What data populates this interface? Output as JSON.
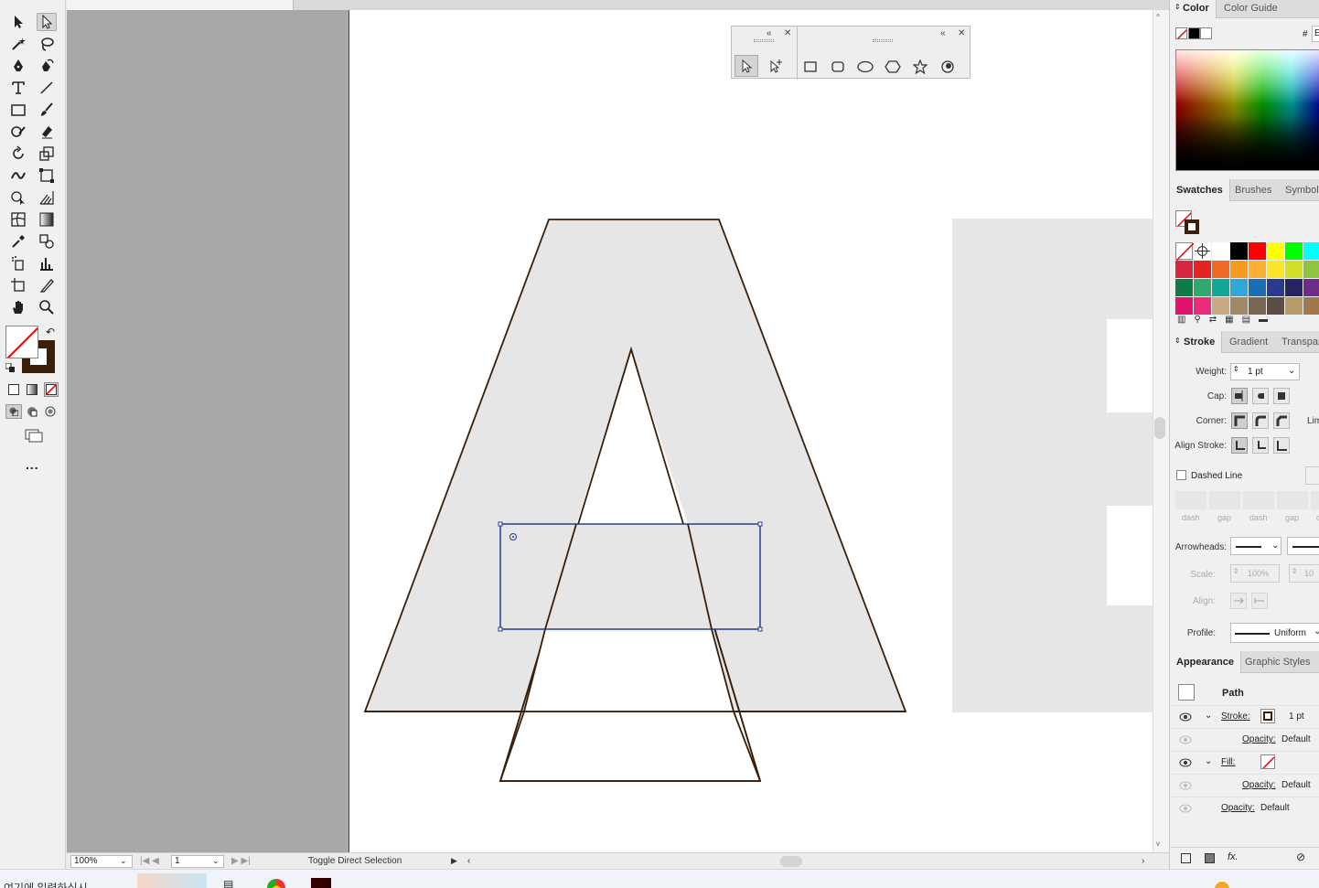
{
  "toolbar": {
    "tools": [
      "selection-tool",
      "direct-selection-tool",
      "magic-wand-tool",
      "lasso-tool",
      "pen-tool",
      "curvature-tool",
      "type-tool",
      "line-segment-tool",
      "rectangle-tool",
      "paintbrush-tool",
      "shaper-tool",
      "eraser-tool",
      "rotate-tool",
      "scale-tool",
      "width-tool",
      "free-transform-tool",
      "shape-builder-tool",
      "perspective-grid-tool",
      "mesh-tool",
      "gradient-tool",
      "eyedropper-tool",
      "blend-tool",
      "symbol-sprayer-tool",
      "column-graph-tool",
      "artboard-tool",
      "slice-tool",
      "hand-tool",
      "zoom-tool"
    ],
    "more_label": "..."
  },
  "floating_panel": {
    "left_tools": [
      "direct-selection",
      "add-anchor"
    ],
    "shape_tools": [
      "rectangle",
      "rounded-rectangle",
      "ellipse",
      "polygon",
      "star",
      "flare"
    ]
  },
  "status": {
    "zoom": "100%",
    "artboard": "1",
    "tool_hint": "Toggle Direct Selection"
  },
  "color_panel": {
    "tabs": [
      "Color",
      "Color Guide"
    ],
    "hex_label": "#",
    "hex_value": "E"
  },
  "swatches_panel": {
    "tabs": [
      "Swatches",
      "Brushes",
      "Symbols"
    ],
    "rows": [
      [
        "#none",
        "#reg",
        "#ffffff",
        "#000000",
        "#ff0000",
        "#ffff00",
        "#00ff00",
        "#00ffff"
      ],
      [
        "#d7263d",
        "#e52421",
        "#ef6a23",
        "#f59c1e",
        "#fbb034",
        "#fde42b",
        "#d2df27",
        "#8cc540"
      ],
      [
        "#0f7b45",
        "#2eaa6f",
        "#13a79a",
        "#2fa8d9",
        "#1b6db5",
        "#2b3a8f",
        "#242664",
        "#6b2c8b"
      ],
      [
        "#e2136e",
        "#ec2c7a",
        "#c8a983",
        "#a08868",
        "#7a6655",
        "#5c4d45",
        "#b89968",
        "#a0784e"
      ]
    ]
  },
  "stroke_panel": {
    "tabs": [
      "Stroke",
      "Gradient",
      "Transparency"
    ],
    "weight_label": "Weight:",
    "weight_value": "1 pt",
    "cap_label": "Cap:",
    "corner_label": "Corner:",
    "limit_label": "Lim",
    "align_label": "Align Stroke:",
    "dashed_label": "Dashed Line",
    "dash_labels": [
      "dash",
      "gap",
      "dash",
      "gap",
      "d"
    ],
    "arrowheads_label": "Arrowheads:",
    "scale_label": "Scale:",
    "scale_value": "100%",
    "scale_value2": "10",
    "align2_label": "Align:",
    "profile_label": "Profile:",
    "profile_value": "Uniform"
  },
  "appearance_panel": {
    "tabs": [
      "Appearance",
      "Graphic Styles"
    ],
    "object": "Path",
    "stroke_label": "Stroke:",
    "stroke_value": "1 pt",
    "opacity_label": "Opacity:",
    "opacity_value": "Default",
    "fill_label": "Fill:",
    "fx_label": "fx."
  },
  "taskbar": {
    "search_text": "여기에 입력하십시"
  },
  "colors": {
    "stroke_brown": "#3a1f0a",
    "selection_blue": "#2b3a8f",
    "shape_fill": "#e6e6e6"
  }
}
